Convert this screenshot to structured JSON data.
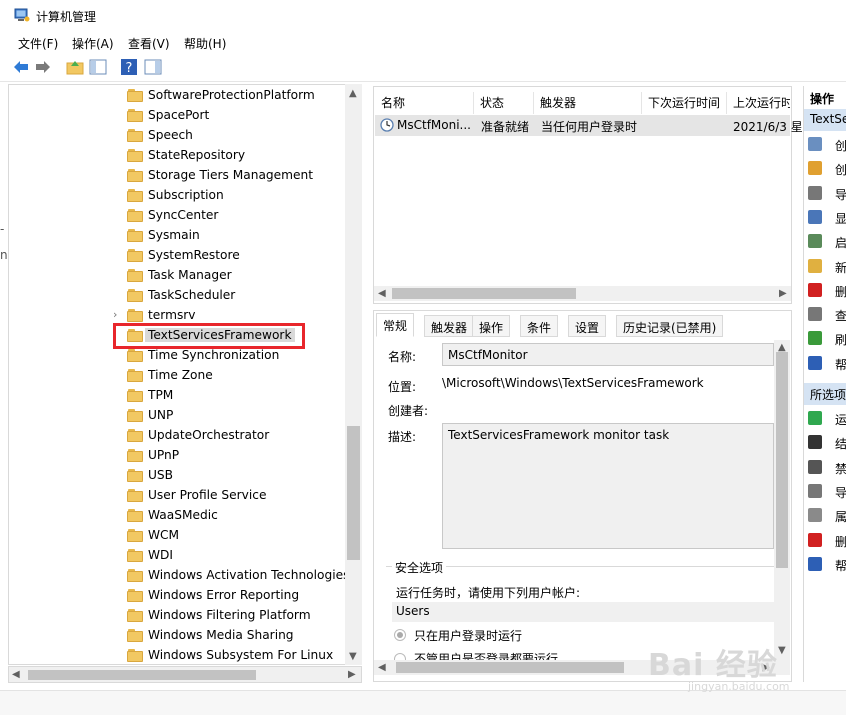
{
  "window": {
    "title": "计算机管理"
  },
  "menu": [
    "文件(F)",
    "操作(A)",
    "查看(V)",
    "帮助(H)"
  ],
  "left_edge_text": [
    "-",
    "n"
  ],
  "tree": {
    "items": [
      "SoftwareProtectionPlatform",
      "SpacePort",
      "Speech",
      "StateRepository",
      "Storage Tiers Management",
      "Subscription",
      "SyncCenter",
      "Sysmain",
      "SystemRestore",
      "Task Manager",
      "TaskScheduler",
      "termsrv",
      "TextServicesFramework",
      "Time Synchronization",
      "Time Zone",
      "TPM",
      "UNP",
      "UpdateOrchestrator",
      "UPnP",
      "USB",
      "User Profile Service",
      "WaaSMedic",
      "WCM",
      "WDI",
      "Windows Activation Technologies",
      "Windows Error Reporting",
      "Windows Filtering Platform",
      "Windows Media Sharing",
      "Windows Subsystem For Linux"
    ],
    "selected": "TextServicesFramework"
  },
  "task_list": {
    "columns": [
      "名称",
      "状态",
      "触发器",
      "下次运行时间",
      "上次运行时"
    ],
    "rows": [
      {
        "name": "MsCtfMoni...",
        "status": "准备就绪",
        "trigger": "当任何用户登录时",
        "next": "",
        "last": "2021/6/3 星"
      }
    ]
  },
  "detail": {
    "tabs": [
      "常规",
      "触发器",
      "操作",
      "条件",
      "设置",
      "历史记录(已禁用)"
    ],
    "name_label": "名称:",
    "name_value": "MsCtfMonitor",
    "location_label": "位置:",
    "location_value": "\\Microsoft\\Windows\\TextServicesFramework",
    "author_label": "创建者:",
    "desc_label": "描述:",
    "desc_value": "TextServicesFramework monitor task",
    "security_title": "安全选项",
    "run_as_label": "运行任务时，请使用下列用户帐户:",
    "user_value": "Users",
    "radio1": "只在用户登录时运行",
    "radio2": "不管用户是否登录都要运行"
  },
  "actions": {
    "header": "操作",
    "section1": "TextSe",
    "items1": [
      "创",
      "创",
      "导",
      "显",
      "启",
      "新",
      "删",
      "查",
      "刷",
      "帮"
    ],
    "section2": "所选项",
    "items2": [
      "运",
      "结",
      "禁",
      "导",
      "属",
      "删",
      "帮"
    ]
  },
  "watermark": {
    "main": "Bai 经验",
    "sub": "jingyan.baidu.com"
  }
}
